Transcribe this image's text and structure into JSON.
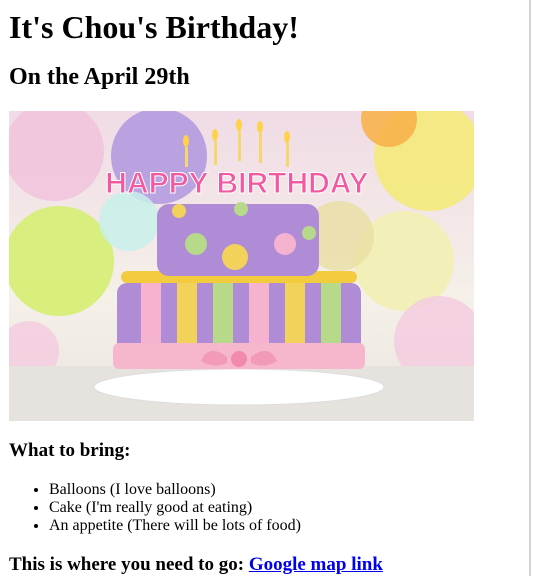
{
  "page": {
    "title": "It's Chou's Birthday!",
    "subtitle": "On the April 29th",
    "hero_image": {
      "topper_text": "HAPPY BIRTHDAY",
      "colors": {
        "cake_purple": "#b08bd6",
        "cake_pink": "#f5b3cf",
        "cake_yellow": "#f2d25a",
        "cake_green": "#b7d98a",
        "ribbon": "#f6b6cc"
      }
    },
    "bring": {
      "heading": "What to bring:",
      "items": [
        "Balloons (I love balloons)",
        "Cake (I'm really good at eating)",
        "An appetite (There will be lots of food)"
      ]
    },
    "destination": {
      "label": "This is where you need to go:",
      "link_text": "Google map link"
    }
  }
}
